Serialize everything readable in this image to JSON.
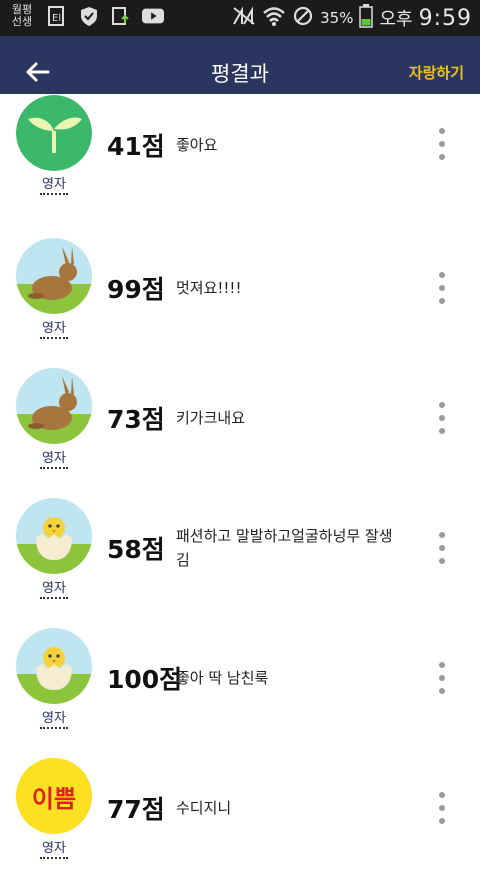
{
  "status_bar": {
    "carrier": [
      "월평",
      "선생"
    ],
    "battery_percent": "35%",
    "ampm": "오후",
    "time": "9:59",
    "icons": [
      "keyboard-icon",
      "shield-icon",
      "file-upload-icon",
      "youtube-icon",
      "no-sim-icon",
      "wifi-icon",
      "do-not-disturb-icon",
      "battery-icon"
    ]
  },
  "header": {
    "title": "평결과",
    "boast_label": "자랑하기",
    "back_icon": "arrow-left-icon",
    "bg_color": "#2a3560",
    "accent_color": "#f0c020"
  },
  "reviews": [
    {
      "avatar": "sprout",
      "author": "영자",
      "score": "41점",
      "comment": "좋아요"
    },
    {
      "avatar": "rabbit",
      "author": "영자",
      "score": "99점",
      "comment": "멋져요!!!!"
    },
    {
      "avatar": "rabbit",
      "author": "영자",
      "score": "73점",
      "comment": "키가크내요"
    },
    {
      "avatar": "chick",
      "author": "영자",
      "score": "58점",
      "comment": "패션하고 말발하고얼굴하넝무 잘생김"
    },
    {
      "avatar": "chick",
      "author": "영자",
      "score": "100점",
      "comment": "좋아 딱 남친룩"
    },
    {
      "avatar": "pretty-badge",
      "avatar_text": "이쁨",
      "author": "영자",
      "score": "77점",
      "comment": "수디지니"
    }
  ]
}
